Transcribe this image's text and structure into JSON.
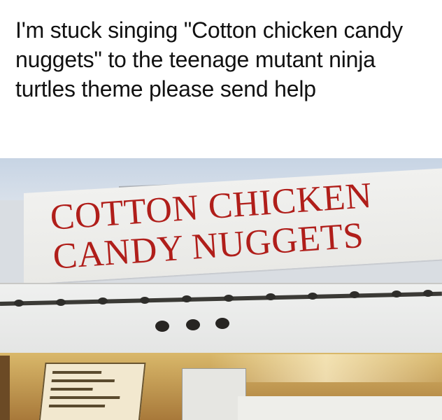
{
  "caption": {
    "text": "I'm stuck singing \"Cotton chicken candy nuggets\" to the teenage mutant ninja turtles theme please send help"
  },
  "photo": {
    "sign": {
      "line1": "COTTON CHICKEN",
      "line2": "CANDY NUGGETS",
      "text_color": "#b01e1a"
    }
  }
}
